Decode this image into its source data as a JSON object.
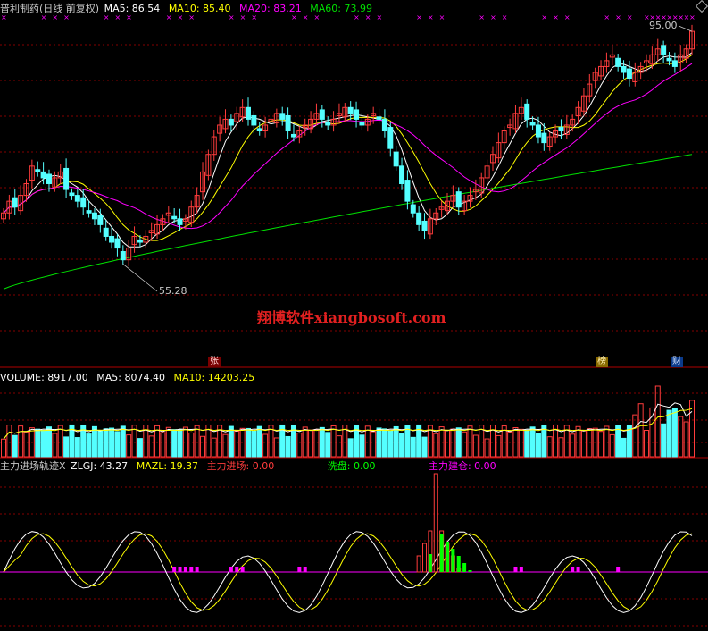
{
  "colors": {
    "up": "#ff3c3c",
    "down": "#54ffff",
    "ma5": "#ffffff",
    "ma10": "#ffff00",
    "ma20": "#ff00ff",
    "ma60": "#00e000",
    "grid": "#b00000",
    "white": "#ffffff"
  },
  "header": {
    "title": "普利制药(日线 前复权)",
    "ma5": "MA5: 86.54",
    "ma10": "MA10: 85.40",
    "ma20": "MA20: 83.21",
    "ma60": "MA60: 73.99"
  },
  "price_labels": {
    "high": "95.00",
    "low": "55.28"
  },
  "watermark": "翔博软件xiangbosoft.com",
  "event_tags": [
    "张",
    "榜",
    "财"
  ],
  "volume_header": {
    "volume": "VOLUME: 8917.00",
    "ma5": "MA5: 8074.40",
    "ma10": "MA10: 14203.25"
  },
  "indicator_header": {
    "name": "主力进场轨迹X",
    "zlgj": "ZLGJ: 43.27",
    "mazl": "MAZL: 19.37",
    "enter": "主力进场: 0.00",
    "wash": "洗盘: 0.00",
    "build": "主力建仓: 0.00"
  },
  "chart_data": [
    {
      "type": "candlestick",
      "title": "普利制药(日线 前复权)",
      "series": [
        {
          "name": "MA5",
          "last": 86.54
        },
        {
          "name": "MA10",
          "last": 85.4
        },
        {
          "name": "MA20",
          "last": 83.21
        },
        {
          "name": "MA60",
          "last": 73.99
        }
      ],
      "annotations": [
        {
          "label": "95.00",
          "y": 95.0
        },
        {
          "label": "55.28",
          "y": 55.28
        }
      ],
      "ylim": [
        50,
        97
      ],
      "closes": [
        64,
        66,
        65,
        67,
        69,
        72,
        71,
        70,
        69,
        70,
        71,
        68,
        67,
        66,
        65,
        64,
        63,
        62,
        60,
        59,
        58,
        56,
        58,
        60,
        59,
        60,
        61,
        62,
        63,
        64,
        63,
        62,
        63,
        65,
        67,
        71,
        74,
        77,
        79,
        80,
        79,
        81,
        82,
        80,
        79,
        78,
        79,
        80,
        81,
        80,
        78,
        77,
        78,
        79,
        80,
        81,
        80,
        79,
        80,
        81,
        82,
        81,
        80,
        79,
        80,
        81,
        80,
        78,
        75,
        72,
        69,
        66,
        64,
        62,
        61,
        63,
        64,
        65,
        66,
        67,
        65,
        66,
        67,
        68,
        70,
        72,
        74,
        76,
        78,
        79,
        81,
        82,
        80,
        79,
        77,
        76,
        77,
        78,
        78,
        79,
        80,
        82,
        84,
        86,
        88,
        89,
        90,
        91,
        89,
        88,
        87,
        88,
        89,
        90,
        91,
        92,
        91,
        90,
        89,
        91,
        92,
        95
      ],
      "ma60_end": 73.99
    },
    {
      "type": "bar",
      "title": "VOLUME",
      "series": [
        {
          "name": "VOLUME",
          "last": 8917.0
        },
        {
          "name": "MA5",
          "last": 8074.4
        },
        {
          "name": "MA10",
          "last": 14203.25
        }
      ]
    },
    {
      "type": "line",
      "title": "主力进场轨迹X",
      "series": [
        {
          "name": "ZLGJ",
          "last": 43.27
        },
        {
          "name": "MAZL",
          "last": 19.37
        },
        {
          "name": "主力进场",
          "last": 0.0
        },
        {
          "name": "洗盘",
          "last": 0.0
        },
        {
          "name": "主力建仓",
          "last": 0.0
        }
      ]
    }
  ]
}
